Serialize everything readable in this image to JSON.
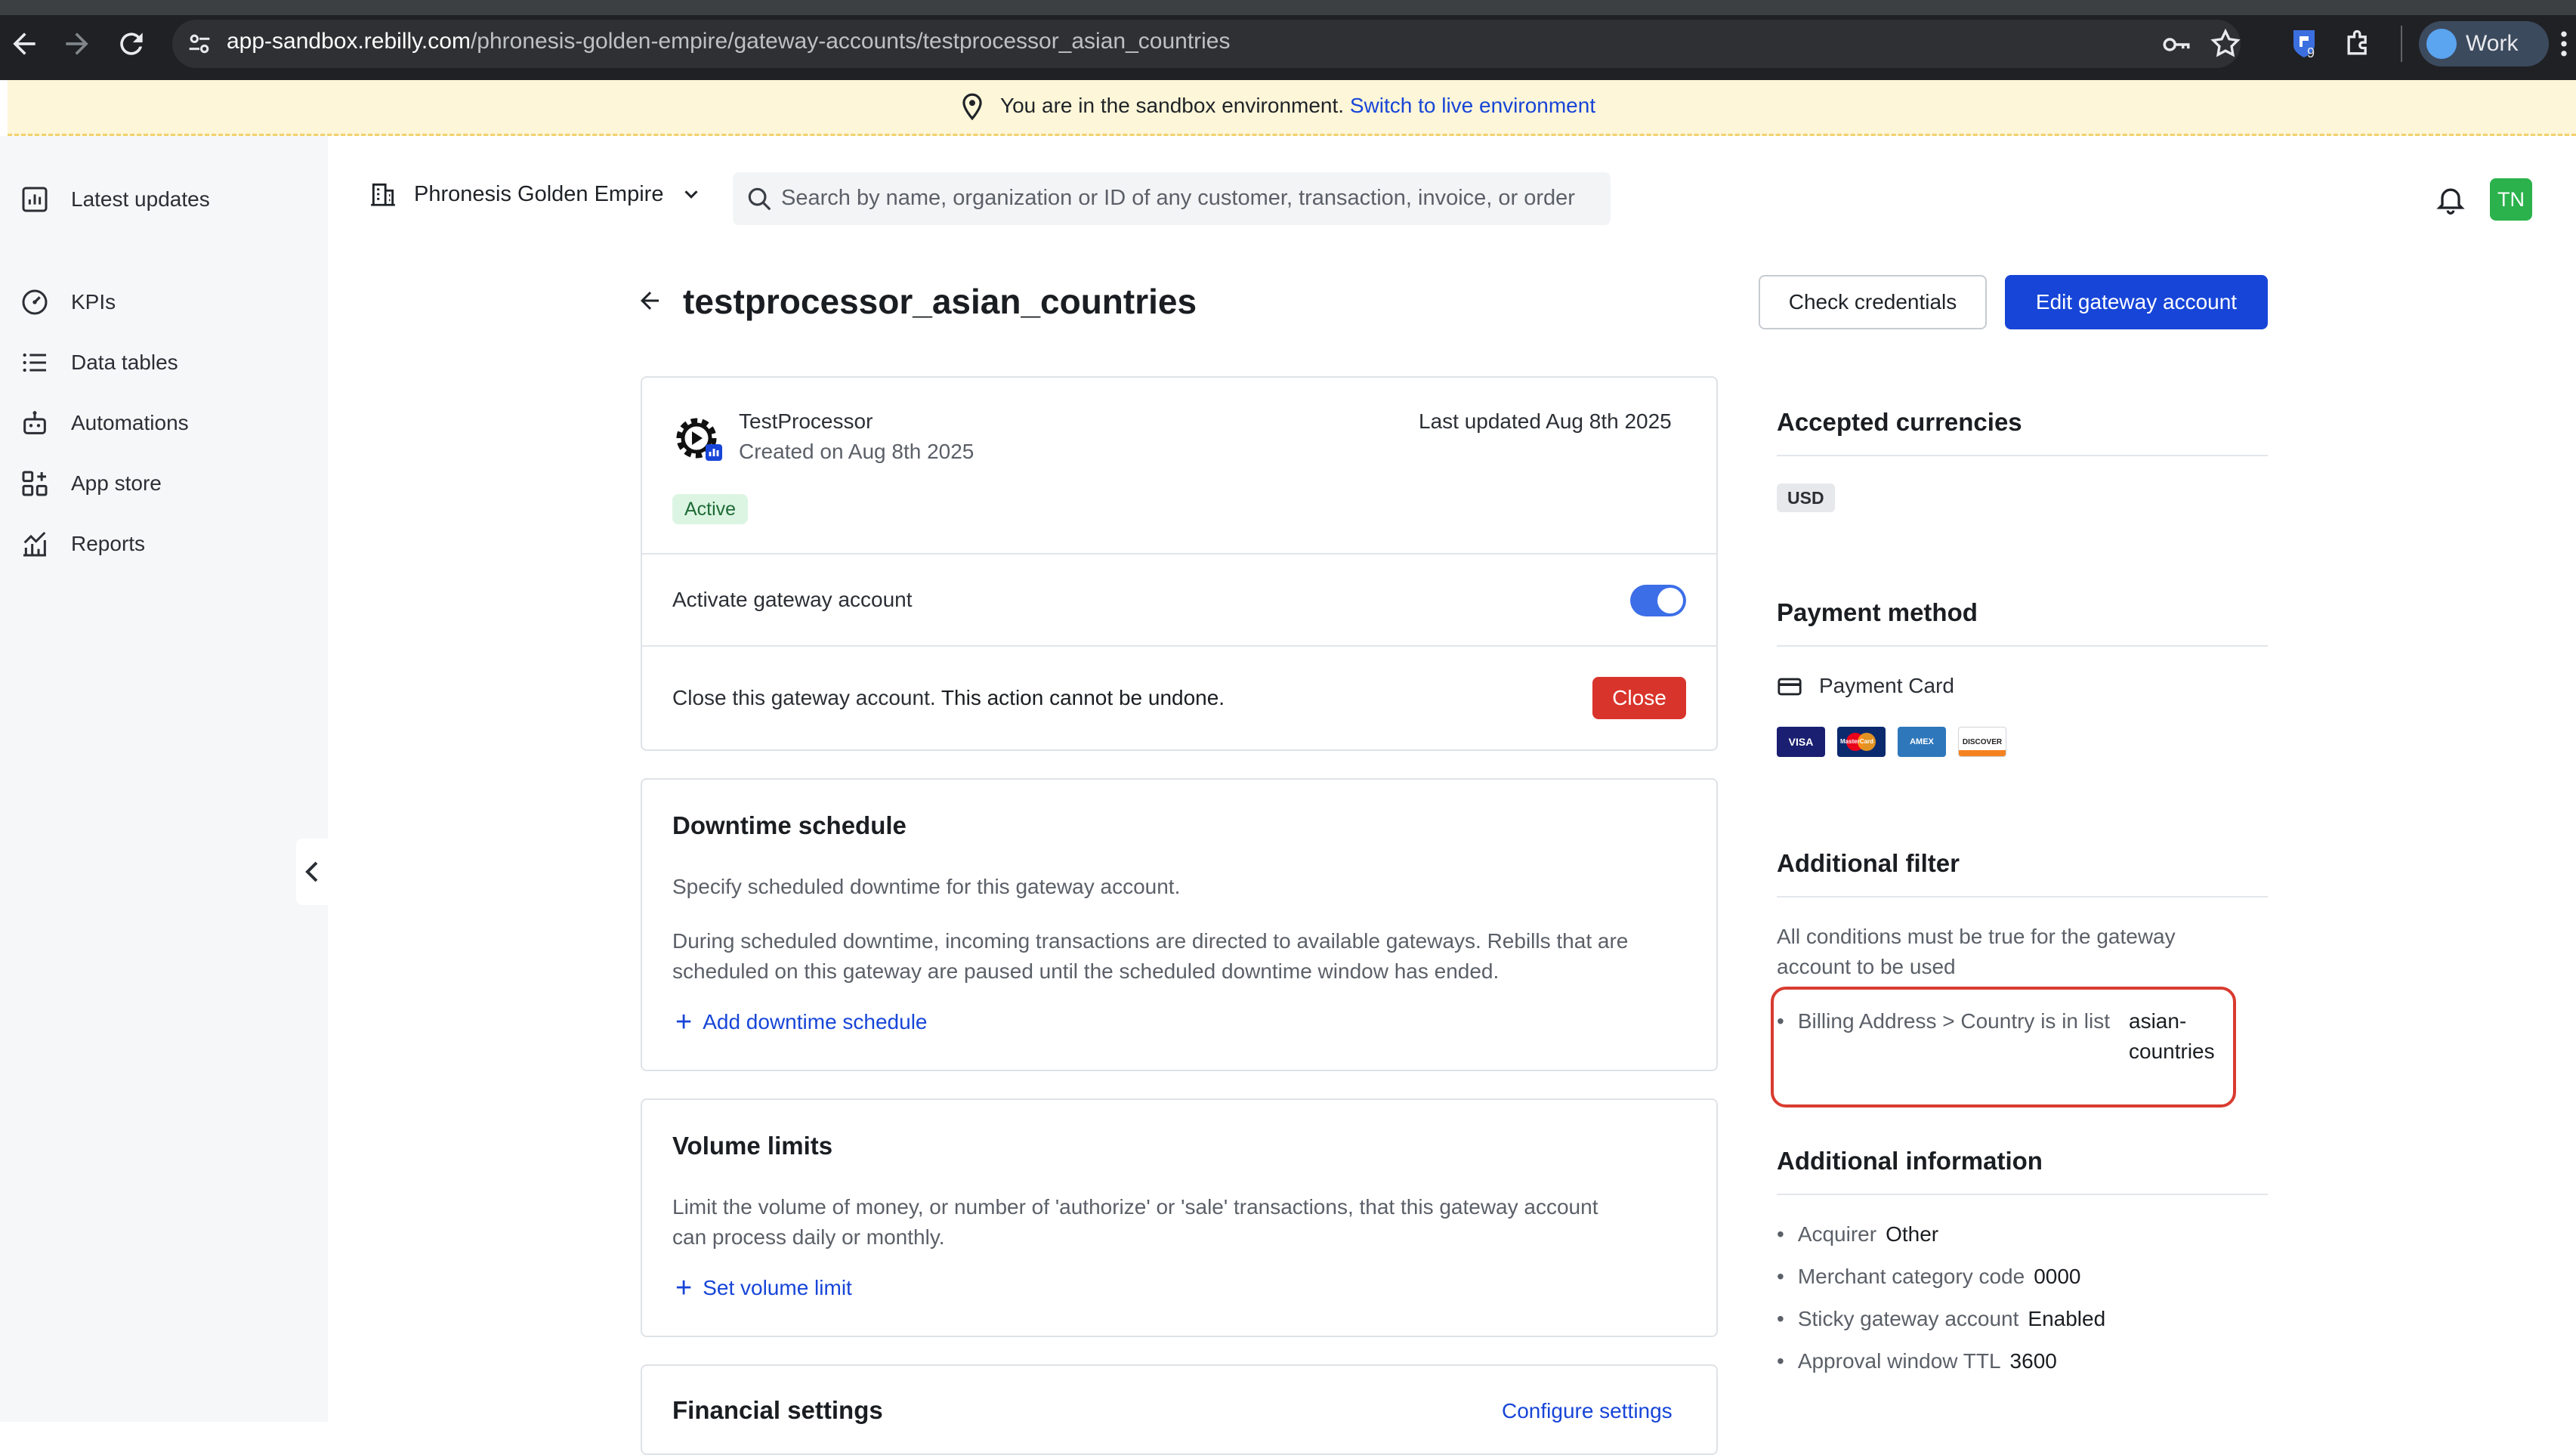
{
  "browser": {
    "url_host": "app-sandbox.rebilly.com",
    "url_path": "/phronesis-golden-empire/gateway-accounts/testprocessor_asian_countries",
    "extension_badge": "9",
    "profile_label": "Work"
  },
  "banner": {
    "text": "You are in the sandbox environment.",
    "link": "Switch to live environment"
  },
  "sidebar": {
    "items": [
      {
        "label": "Latest updates",
        "icon": "chart-icon"
      },
      {
        "label": "KPIs",
        "icon": "gauge-icon"
      },
      {
        "label": "Data tables",
        "icon": "list-icon"
      },
      {
        "label": "Automations",
        "icon": "robot-icon"
      },
      {
        "label": "App store",
        "icon": "apps-icon"
      },
      {
        "label": "Reports",
        "icon": "reports-icon"
      }
    ]
  },
  "topbar": {
    "org_name": "Phronesis Golden Empire",
    "search_placeholder": "Search by name, organization or ID of any customer, transaction, invoice, or order",
    "avatar_initials": "TN"
  },
  "page": {
    "title": "testprocessor_asian_countries",
    "check_credentials": "Check credentials",
    "edit_gateway": "Edit gateway account"
  },
  "summary_card": {
    "processor": "TestProcessor",
    "created": "Created on Aug 8th 2025",
    "last_updated": "Last updated Aug 8th 2025",
    "status": "Active",
    "activate_label": "Activate gateway account",
    "activate_on": true,
    "close_text": "Close this gateway account.",
    "close_warning": "This action cannot be undone.",
    "close_button": "Close"
  },
  "downtime": {
    "title": "Downtime schedule",
    "desc1": "Specify scheduled downtime for this gateway account.",
    "desc2_line1": "During scheduled downtime, incoming transactions are directed to available gateways. Rebills that are",
    "desc2_line2": "scheduled on this gateway are paused until the scheduled downtime window has ended.",
    "action": "Add downtime schedule"
  },
  "volume": {
    "title": "Volume limits",
    "desc_line1": "Limit the volume of money, or number of 'authorize' or 'sale' transactions, that this gateway account",
    "desc_line2": "can process daily or monthly.",
    "action": "Set volume limit"
  },
  "financial": {
    "title": "Financial settings",
    "action": "Configure settings"
  },
  "right": {
    "currencies_title": "Accepted currencies",
    "currency": "USD",
    "payment_title": "Payment method",
    "payment_method": "Payment Card",
    "card_brands": [
      "VISA",
      "MasterCard",
      "AMEX",
      "DISCOVER"
    ],
    "filter_title": "Additional filter",
    "filter_desc_line1": "All conditions must be true for the gateway",
    "filter_desc_line2": "account to be used",
    "filter_condition": "Billing Address > Country is in list",
    "filter_value_line1": "asian-",
    "filter_value_line2": "countries",
    "info_title": "Additional information",
    "info": [
      {
        "label": "Acquirer",
        "value": "Other"
      },
      {
        "label": "Merchant category code",
        "value": "0000"
      },
      {
        "label": "Sticky gateway account",
        "value": "Enabled"
      },
      {
        "label": "Approval window TTL",
        "value": "3600"
      }
    ]
  },
  "colors": {
    "primary": "#1745d8",
    "danger": "#d9342b",
    "active_badge_bg": "#dcf5e3",
    "banner_bg": "#fdf6d8",
    "highlight": "#d93b30"
  }
}
